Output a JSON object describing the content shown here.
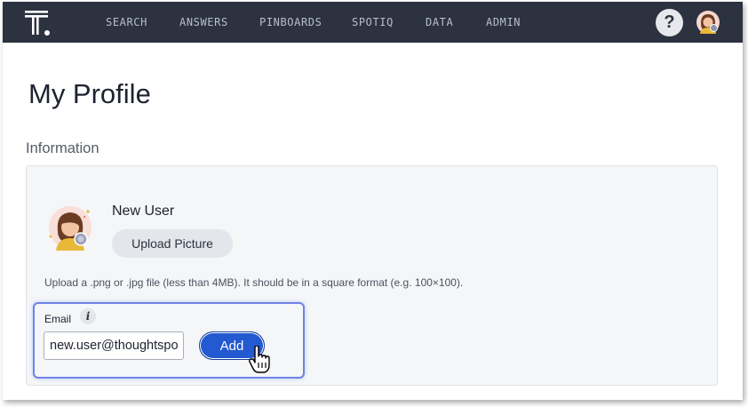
{
  "topnav": {
    "items": [
      {
        "label": "SEARCH"
      },
      {
        "label": "ANSWERS"
      },
      {
        "label": "PINBOARDS"
      },
      {
        "label": "SPOTIQ"
      },
      {
        "label": "DATA"
      },
      {
        "label": "ADMIN"
      }
    ],
    "help_label": "?",
    "logo_icon": "thoughtspot-logo",
    "avatar_icon": "user-avatar-icon",
    "background_color": "#2c323f"
  },
  "page": {
    "title": "My Profile",
    "section_title": "Information"
  },
  "profile": {
    "name": "New User",
    "upload_button_label": "Upload Picture",
    "upload_hint": "Upload a .png or .jpg file (less than 4MB). It should be in a square format (e.g. 100×100).",
    "avatar_icon": "user-avatar-icon"
  },
  "email": {
    "label": "Email",
    "info_icon_label": "i",
    "value": "new.user@thoughtspot.com",
    "add_button_label": "Add",
    "highlight_color": "#6f84e8",
    "button_color": "#2359d1"
  }
}
